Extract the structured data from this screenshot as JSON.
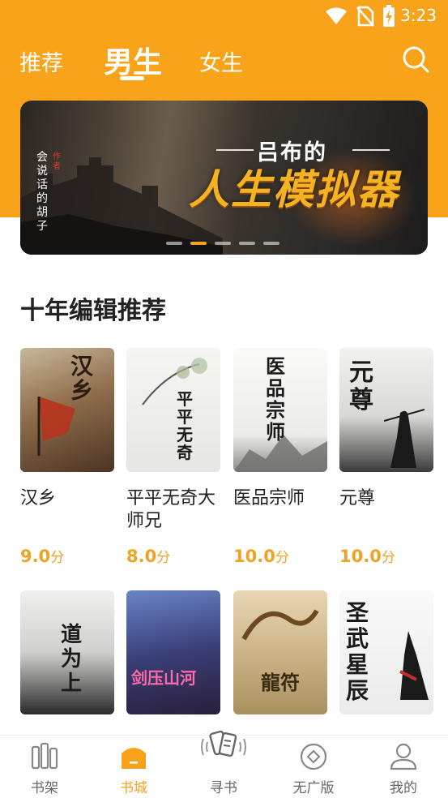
{
  "status_bar": {
    "time": "3:23"
  },
  "top_tabs": [
    {
      "label": "推荐",
      "active": false
    },
    {
      "label": "男生",
      "active": true
    },
    {
      "label": "女生",
      "active": false
    }
  ],
  "banner": {
    "subtitle": "吕布的",
    "title": "人生模拟器",
    "author": "会说话的胡子",
    "author_seal": "作者",
    "slides": 5,
    "active_slide": 2
  },
  "section": {
    "title": "十年编辑推荐"
  },
  "books": [
    {
      "name": "汉乡",
      "score": "9.0",
      "unit": "分",
      "cover_title": "汉乡",
      "cover_bg": "#8a6a4a"
    },
    {
      "name": "平平无奇大师兄",
      "score": "8.0",
      "unit": "分",
      "cover_title": "平平无奇",
      "cover_bg": "#f2f2f0"
    },
    {
      "name": "医品宗师",
      "score": "10.0",
      "unit": "分",
      "cover_title": "医品宗师",
      "cover_bg": "#f4f4f2"
    },
    {
      "name": "元尊",
      "score": "10.0",
      "unit": "分",
      "cover_title": "元尊",
      "cover_bg": "#eaeaea"
    }
  ],
  "books_row2": [
    {
      "cover_title": "道为上",
      "cover_bg": "#e8e8e6"
    },
    {
      "cover_title": "剑压山河",
      "cover_bg": "#3a4a7a"
    },
    {
      "cover_title": "龍符",
      "cover_bg": "#d8c8a8"
    },
    {
      "cover_title": "圣武星辰",
      "cover_bg": "#f0f0ee"
    }
  ],
  "bottom_nav": [
    {
      "label": "书架",
      "icon": "bookshelf-icon",
      "active": false
    },
    {
      "label": "书城",
      "icon": "store-icon",
      "active": true
    },
    {
      "label": "寻书",
      "icon": "find-book-icon",
      "active": false
    },
    {
      "label": "无广版",
      "icon": "no-ads-icon",
      "active": false
    },
    {
      "label": "我的",
      "icon": "profile-icon",
      "active": false
    }
  ],
  "colors": {
    "accent": "#F9A31A",
    "score": "#F0A323"
  }
}
